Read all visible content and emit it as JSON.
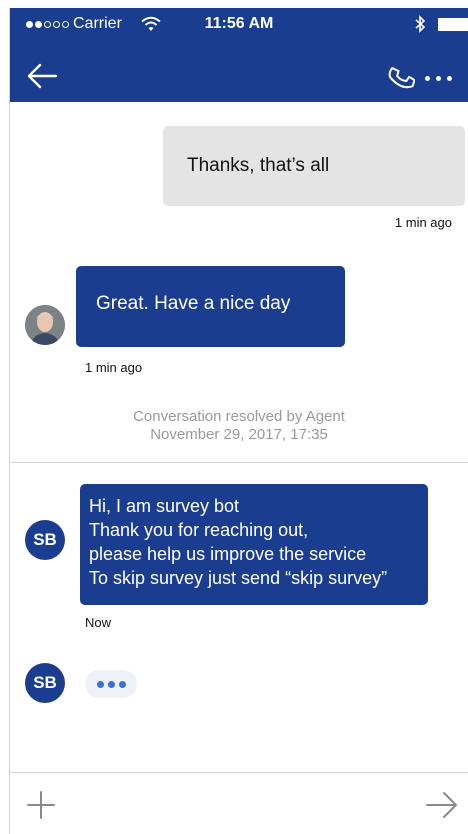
{
  "status_bar": {
    "carrier": "Carrier",
    "time": "11:56 AM"
  },
  "header": {
    "back_icon": "arrow-left-icon",
    "call_icon": "phone-icon",
    "more_icon": "more-horizontal-icon"
  },
  "messages": [
    {
      "from": "user",
      "text": "Thanks, that’s all",
      "timestamp": "1 min ago"
    },
    {
      "from": "agent",
      "text": "Great. Have a nice day",
      "timestamp": "1 min ago"
    }
  ],
  "system_message": {
    "line1": "Conversation resolved by Agent",
    "line2": "November 29, 2017, 17:35"
  },
  "bot": {
    "avatar_initials": "SB",
    "message_lines": [
      "Hi, I am survey bot",
      "Thank you for reaching out,",
      "please help us improve the service",
      "To skip survey just send “skip survey”"
    ],
    "timestamp": "Now"
  },
  "composer": {
    "add_icon": "plus-icon",
    "send_icon": "arrow-right-icon"
  },
  "colors": {
    "brand": "#1b3d8f",
    "user_bubble": "#e4e4e4",
    "typing_dots": "#3d6fd6",
    "system_text": "#9a9a9a"
  }
}
